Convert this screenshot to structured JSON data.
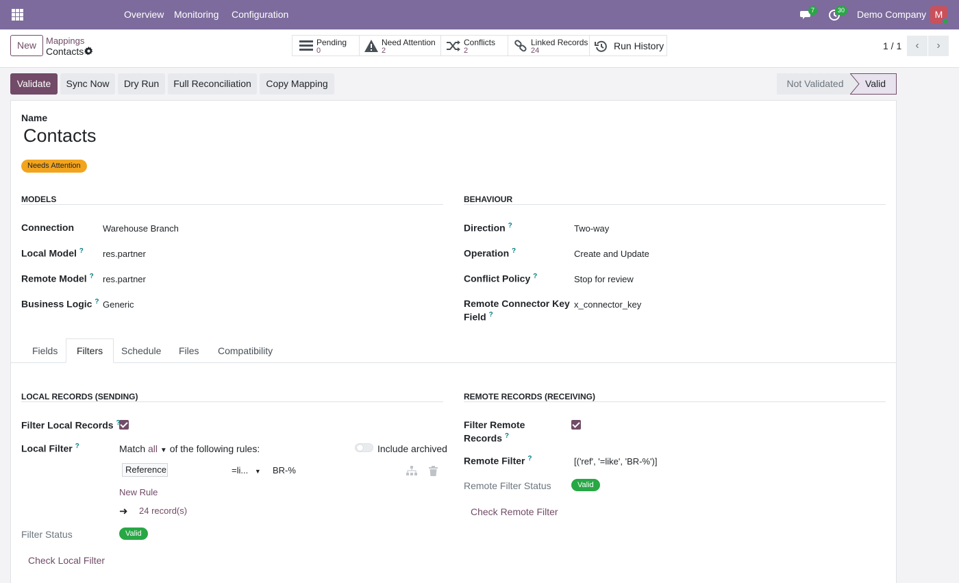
{
  "topbar": {
    "menu": [
      "Overview",
      "Monitoring",
      "Configuration"
    ],
    "messages_count": "7",
    "activities_count": "30",
    "company": "Demo Company",
    "avatar_initial": "M",
    "icons": [
      "apps-grid-icon",
      "chat-icon",
      "clock-icon"
    ],
    "color": "#7c6b9c"
  },
  "controlpanel": {
    "new_label": "New",
    "breadcrumb_parent": "Mappings",
    "breadcrumb_current": "Contacts",
    "smart_buttons": [
      {
        "label": "Pending",
        "value": "0",
        "icon": "tasks-icon"
      },
      {
        "label": "Need Attention",
        "value": "2",
        "icon": "warning-icon"
      },
      {
        "label": "Conflicts",
        "value": "2",
        "icon": "random-icon"
      },
      {
        "label": "Linked Records",
        "value": "24",
        "icon": "link-icon"
      },
      {
        "label": "Run History",
        "icon": "history-icon"
      }
    ],
    "pager": "1 / 1"
  },
  "actions": {
    "validate": "Validate",
    "sync_now": "Sync Now",
    "dry_run": "Dry Run",
    "full_reconciliation": "Full Reconciliation",
    "copy_mapping": "Copy Mapping"
  },
  "statusbar": {
    "not_validated": "Not Validated",
    "valid": "Valid"
  },
  "form": {
    "name_label": "Name",
    "name": "Contacts",
    "state_badge": "Needs Attention",
    "models": {
      "header": "Models",
      "connection_label": "Connection",
      "connection": "Warehouse Branch",
      "local_model_label": "Local Model",
      "local_model": "res.partner",
      "remote_model_label": "Remote Model",
      "remote_model": "res.partner",
      "business_logic_label": "Business Logic",
      "business_logic": "Generic"
    },
    "behaviour": {
      "header": "Behaviour",
      "direction_label": "Direction",
      "direction": "Two-way",
      "operation_label": "Operation",
      "operation": "Create and Update",
      "conflict_policy_label": "Conflict Policy",
      "conflict_policy": "Stop for review",
      "key_field_label_1": "Remote Connector Key",
      "key_field_label_2": "Field",
      "key_field": "x_connector_key"
    },
    "tabs": [
      "Fields",
      "Filters",
      "Schedule",
      "Files",
      "Compatibility"
    ],
    "active_tab": "Filters",
    "local": {
      "header": "Local Records (Sending)",
      "filter_local_label": "Filter Local Records",
      "filter_local_checked": true,
      "local_filter_label": "Local Filter",
      "match_prefix": "Match",
      "match_value": "all",
      "match_suffix": "of the following rules:",
      "include_archived": "Include archived",
      "rule_field": "Reference",
      "rule_operator": "=li...",
      "rule_value": "BR-%",
      "new_rule": "New Rule",
      "records": "24 record(s)",
      "filter_status_label": "Filter Status",
      "filter_status": "Valid",
      "check_button": "Check Local Filter"
    },
    "remote": {
      "header": "Remote Records (Receiving)",
      "filter_remote_label_1": "Filter Remote",
      "filter_remote_label_2": "Records",
      "filter_remote_checked": true,
      "remote_filter_label": "Remote Filter",
      "remote_filter": "[('ref', '=like', 'BR-%')]",
      "remote_filter_status_label": "Remote Filter Status",
      "remote_filter_status": "Valid",
      "check_button": "Check Remote Filter"
    }
  }
}
